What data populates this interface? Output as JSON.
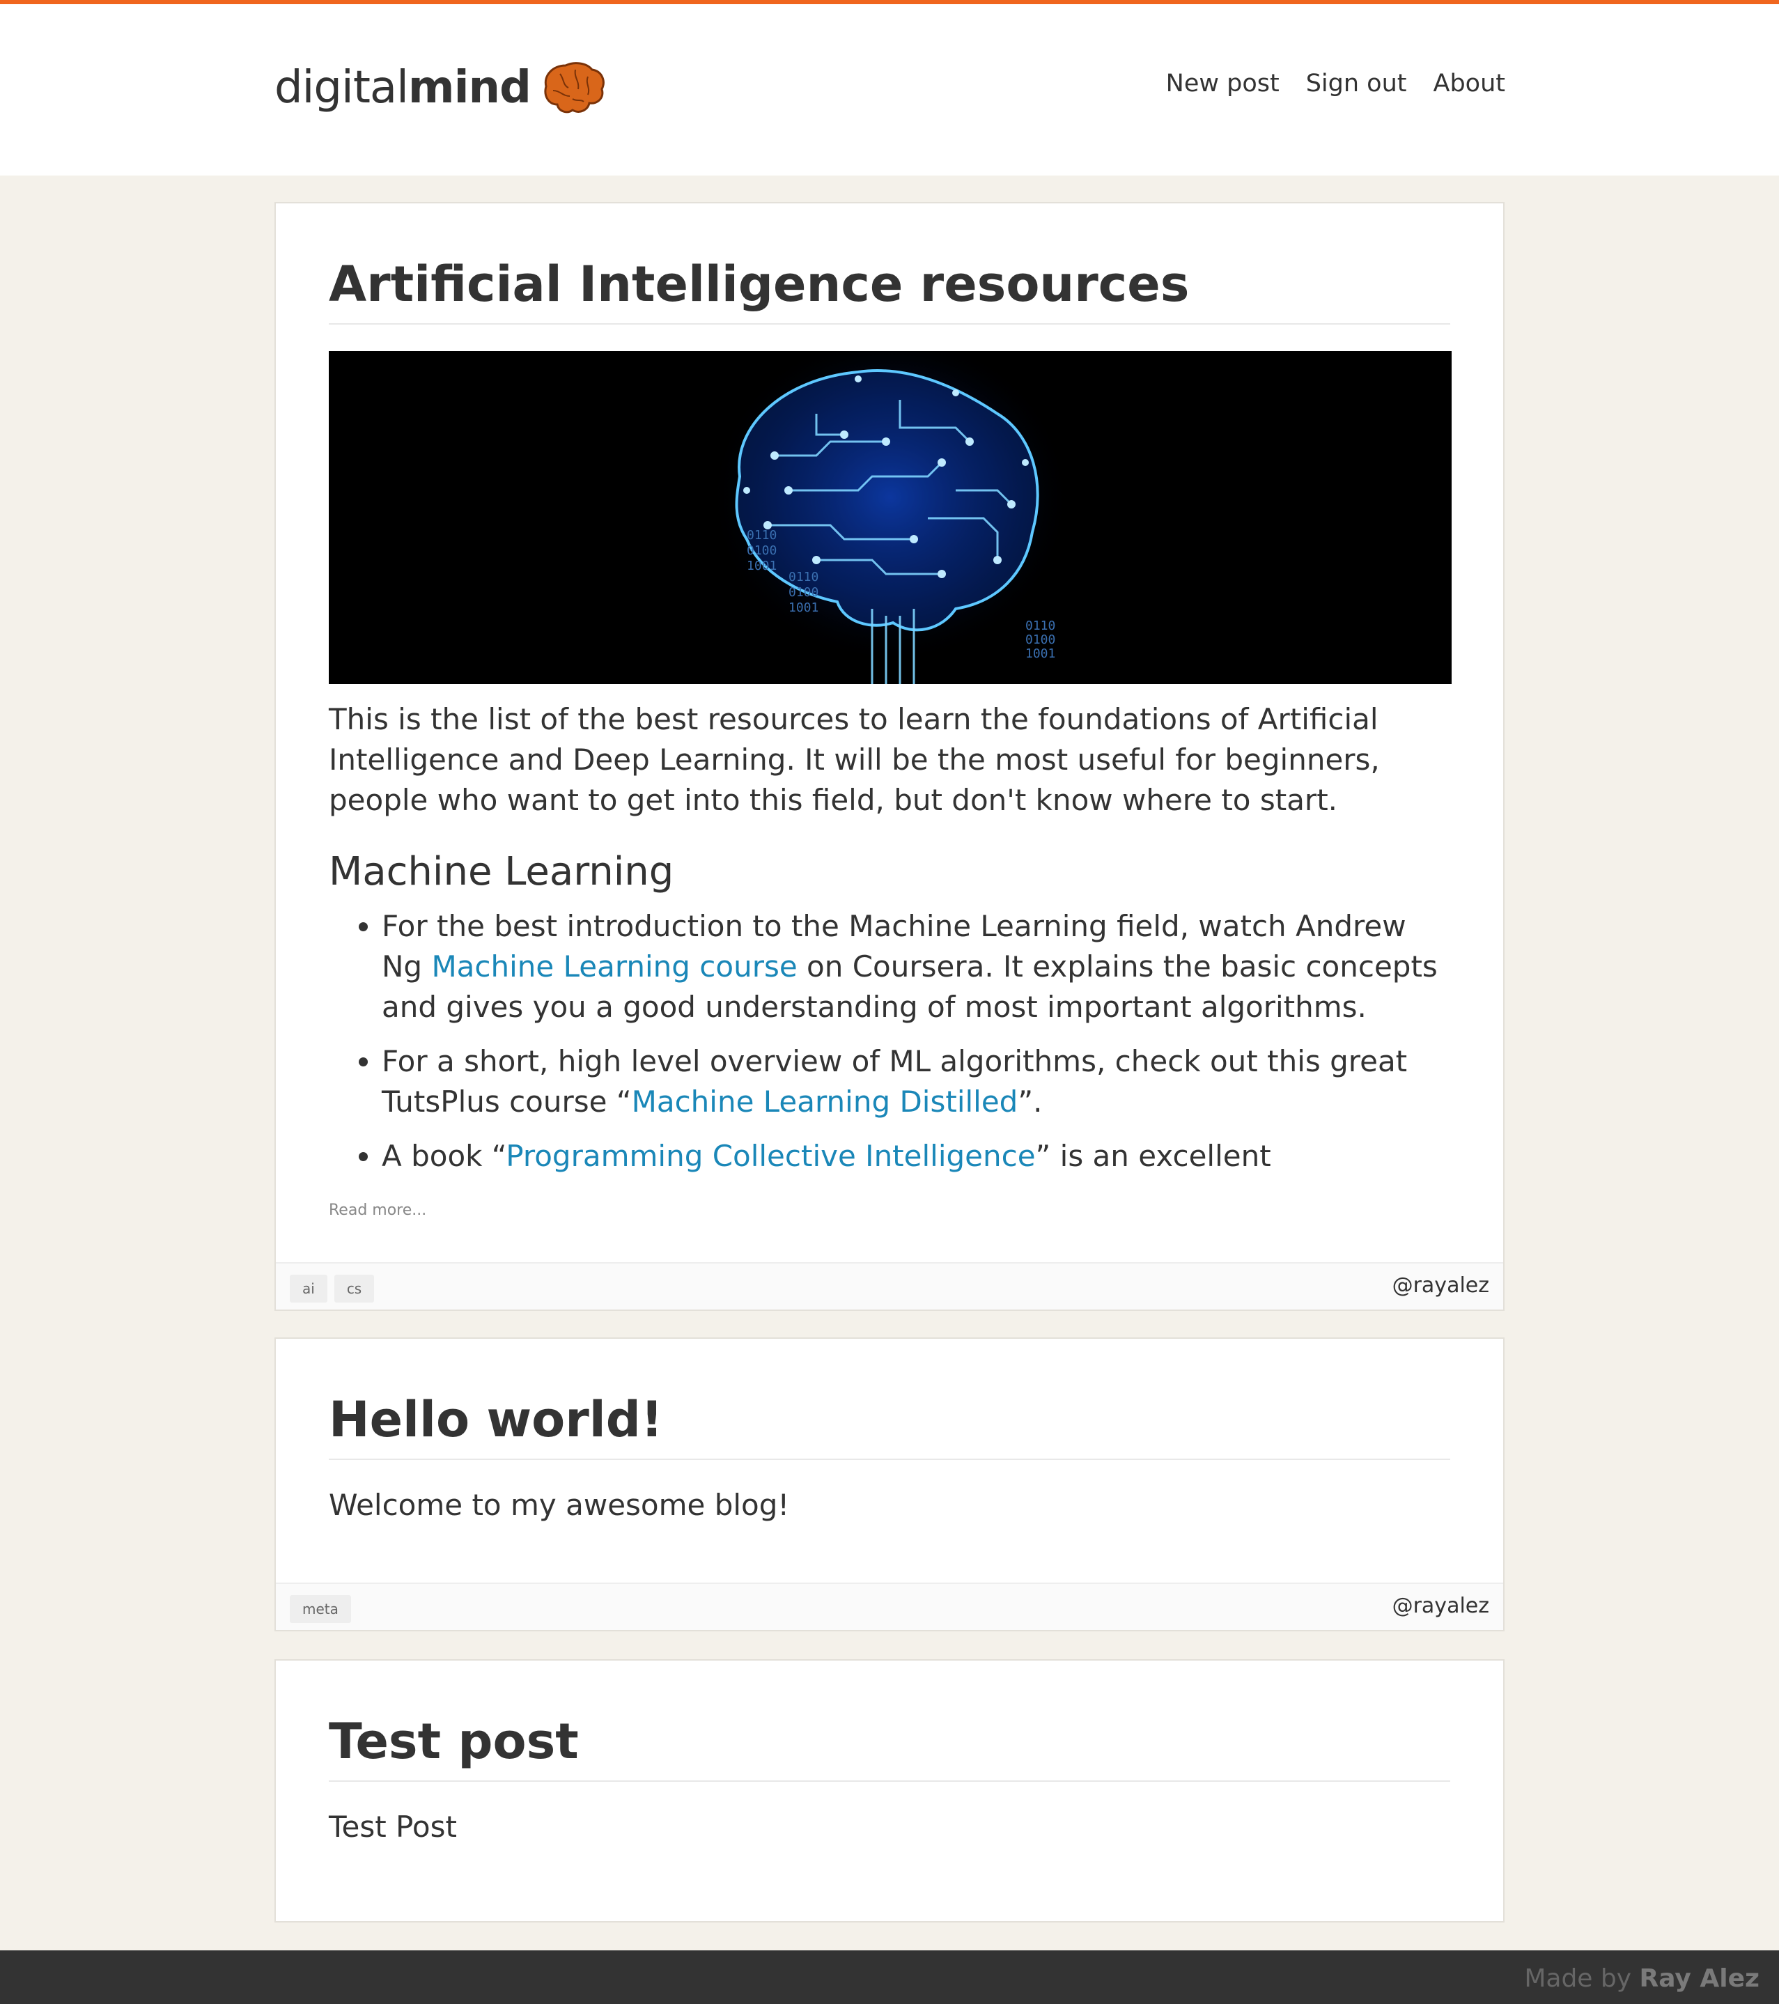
{
  "brand": {
    "name_light": "digital",
    "name_bold": "mind",
    "accent_color": "#f0661e",
    "logo_icon": "brain-icon"
  },
  "nav": {
    "items": [
      {
        "label": "New post"
      },
      {
        "label": "Sign out"
      },
      {
        "label": "About"
      }
    ]
  },
  "posts": [
    {
      "title": "Artificial Intelligence resources",
      "image": "circuit-brain-image",
      "intro": "This is the list of the best resources to learn the foundations of Artificial Intelligence and Deep Learning. It will be the most useful for beginners, people who want to get into this field, but don't know where to start.",
      "section_heading": "Machine Learning",
      "bullets": [
        {
          "before": "For the best introduction to the Machine Learning field, watch Andrew Ng ",
          "link": "Machine Learning course",
          "after": " on Coursera. It explains the basic concepts and gives you a good understanding of most important algorithms."
        },
        {
          "before": "For a short, high level overview of ML algorithms, check out this great TutsPlus course “",
          "link": "Machine Learning Distilled",
          "after": "”."
        },
        {
          "before": "A book “",
          "link": "Programming Collective Intelligence",
          "after": "” is an excellent"
        }
      ],
      "read_more": "Read more...",
      "tags": [
        "ai",
        "cs"
      ],
      "author": "@rayalez"
    },
    {
      "title": "Hello world!",
      "body": "Welcome to my awesome blog!",
      "tags": [
        "meta"
      ],
      "author": "@rayalez"
    },
    {
      "title": "Test post",
      "body": "Test Post"
    }
  ],
  "footer": {
    "made_by": "Made by",
    "author_name": "Ray Alez"
  },
  "colors": {
    "page_background": "#f4f1ea",
    "link": "#1a87b8",
    "footer_background": "#333333"
  }
}
